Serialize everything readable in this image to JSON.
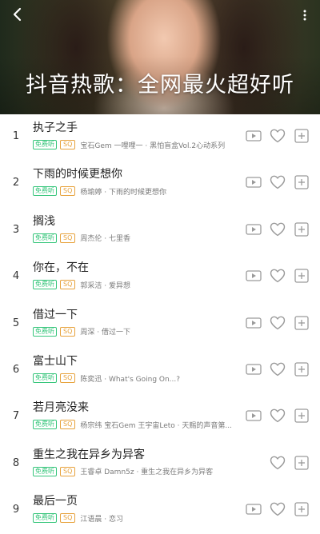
{
  "header": {
    "title": "抖音热歌：全网最火超好听"
  },
  "colors": {
    "free_tag": "#35c57a",
    "sq_tag": "#e7a23c",
    "icon_gray": "#9a9a9a"
  },
  "songs": [
    {
      "index": "1",
      "title": "执子之手",
      "free": "免费听",
      "quality": "SQ",
      "artist": "宝石Gem 一哩哩一 · 黑怕盲盒Vol.2心动系列",
      "has_mv": true
    },
    {
      "index": "2",
      "title": "下雨的时候更想你",
      "free": "免费听",
      "quality": "SQ",
      "artist": "杨瑜婷 · 下雨的时候更想你",
      "has_mv": true
    },
    {
      "index": "3",
      "title": "搁浅",
      "free": "免费听",
      "quality": "SQ",
      "artist": "周杰伦 · 七里香",
      "has_mv": true
    },
    {
      "index": "4",
      "title": "你在，不在",
      "free": "免费听",
      "quality": "SQ",
      "artist": "郭采洁 · 爱异想",
      "has_mv": true
    },
    {
      "index": "5",
      "title": "借过一下",
      "free": "免费听",
      "quality": "SQ",
      "artist": "周深 · 借过一下",
      "has_mv": true
    },
    {
      "index": "6",
      "title": "富士山下",
      "free": "免费听",
      "quality": "SQ",
      "artist": "陈奕迅 · What's Going On...?",
      "has_mv": true
    },
    {
      "index": "7",
      "title": "若月亮没来",
      "free": "免费听",
      "quality": "SQ",
      "artist": "杨宗纬 宝石Gem 王宇宙Leto · 天赐的声音第...",
      "has_mv": true
    },
    {
      "index": "8",
      "title": "重生之我在异乡为异客",
      "free": "免费听",
      "quality": "SQ",
      "artist": "王睿卓 Damn5z · 重生之我在异乡为异客",
      "has_mv": false
    },
    {
      "index": "9",
      "title": "最后一页",
      "free": "免费听",
      "quality": "SQ",
      "artist": "江语晨 · 恋习",
      "has_mv": true
    }
  ]
}
